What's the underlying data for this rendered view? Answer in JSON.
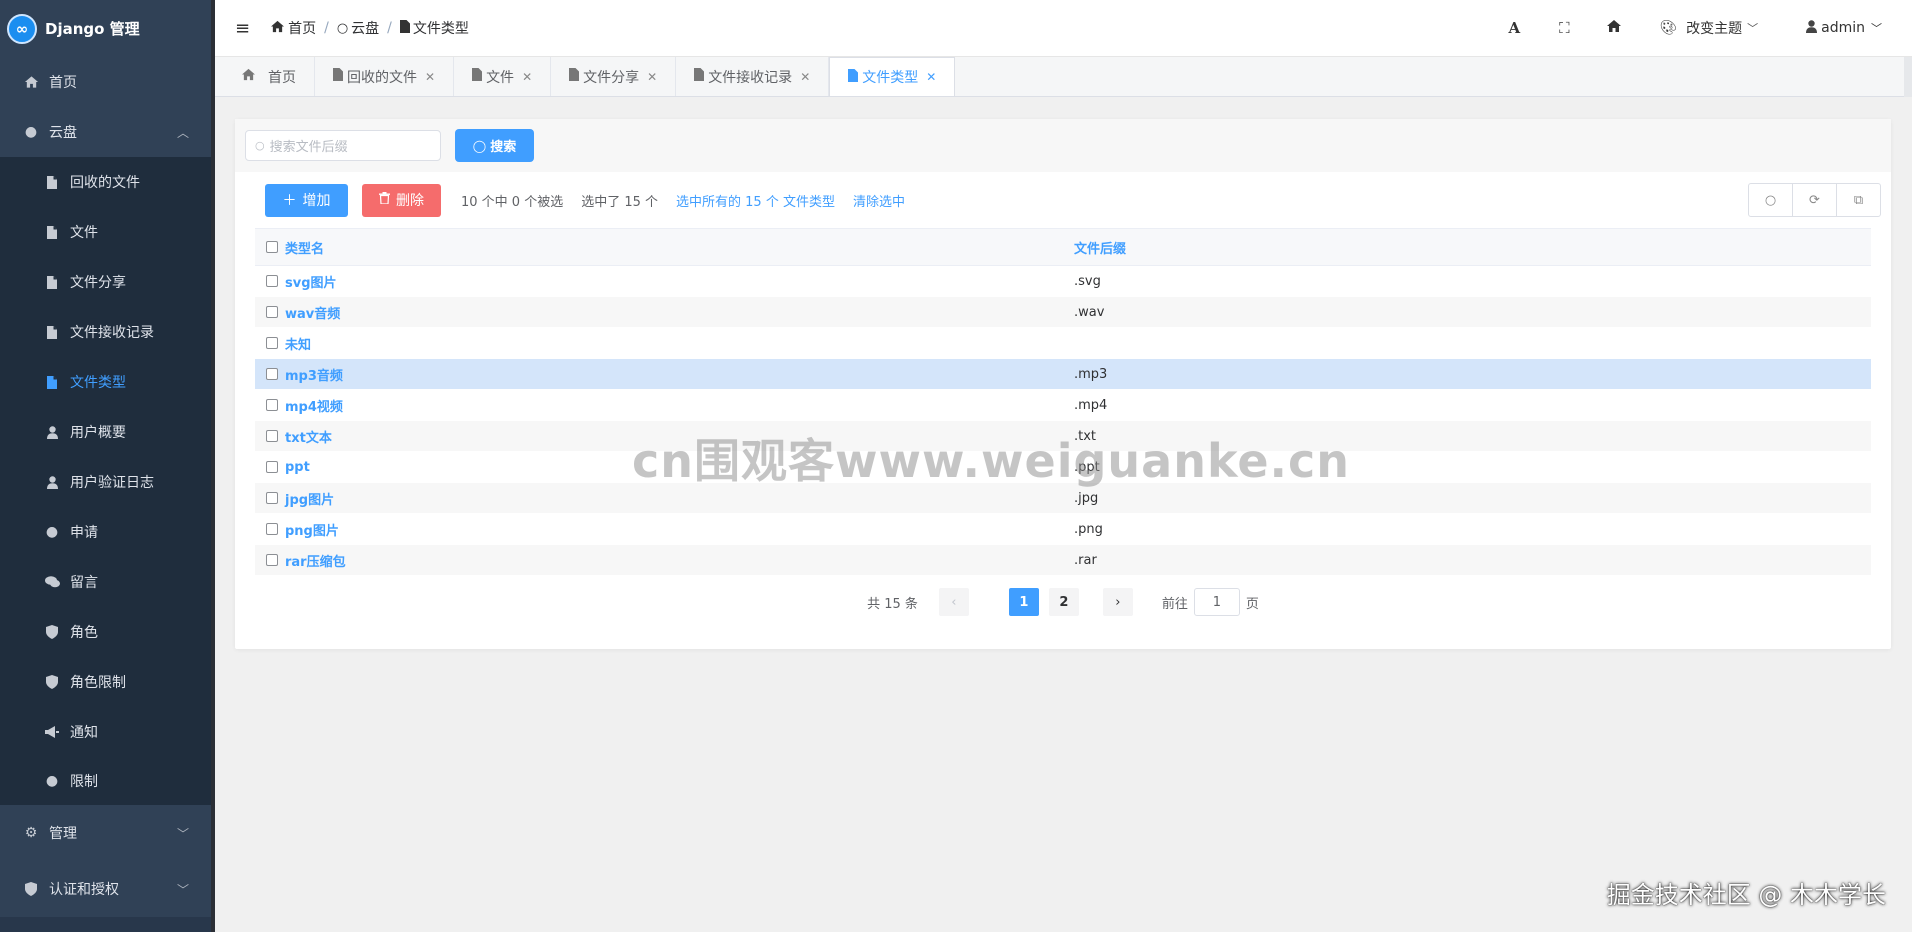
{
  "app": {
    "title": "Django 管理",
    "logo_glyph": "∞"
  },
  "sidebar": {
    "home": "首页",
    "cloud_group": "云盘",
    "cloud_items": [
      {
        "label": "回收的文件",
        "icon": "file-icon"
      },
      {
        "label": "文件",
        "icon": "file-icon"
      },
      {
        "label": "文件分享",
        "icon": "file-icon"
      },
      {
        "label": "文件接收记录",
        "icon": "file-icon"
      },
      {
        "label": "文件类型",
        "icon": "file-icon",
        "active": true
      },
      {
        "label": "用户概要",
        "icon": "user-icon"
      },
      {
        "label": "用户验证日志",
        "icon": "user-icon"
      },
      {
        "label": "申请",
        "icon": "circle-icon"
      },
      {
        "label": "留言",
        "icon": "comments-icon"
      },
      {
        "label": "角色",
        "icon": "shield-icon"
      },
      {
        "label": "角色限制",
        "icon": "shield-icon"
      },
      {
        "label": "通知",
        "icon": "bullhorn-icon"
      },
      {
        "label": "限制",
        "icon": "circle-icon"
      }
    ],
    "manage_group": "管理",
    "auth_group": "认证和授权"
  },
  "topbar": {
    "breadcrumb": [
      "首页",
      "云盘",
      "文件类型"
    ],
    "theme_label": "改变主题",
    "user": "admin"
  },
  "tabs": [
    {
      "label": "首页",
      "closable": false
    },
    {
      "label": "回收的文件",
      "closable": true
    },
    {
      "label": "文件",
      "closable": true
    },
    {
      "label": "文件分享",
      "closable": true
    },
    {
      "label": "文件接收记录",
      "closable": true
    },
    {
      "label": "文件类型",
      "closable": true,
      "active": true
    }
  ],
  "search": {
    "placeholder": "搜索文件后缀",
    "button": "搜索"
  },
  "actions": {
    "add": "增加",
    "delete": "删除",
    "selection_info": "10 个中 0 个被选",
    "selected_count": "选中了 15 个",
    "select_all": "选中所有的 15 个 文件类型",
    "clear": "清除选中"
  },
  "table": {
    "headers": {
      "name": "类型名",
      "suffix": "文件后缀"
    },
    "rows": [
      {
        "name": "svg图片",
        "suffix": ".svg"
      },
      {
        "name": "wav音频",
        "suffix": ".wav"
      },
      {
        "name": "未知",
        "suffix": ""
      },
      {
        "name": "mp3音频",
        "suffix": ".mp3",
        "highlight": true
      },
      {
        "name": "mp4视频",
        "suffix": ".mp4"
      },
      {
        "name": "txt文本",
        "suffix": ".txt"
      },
      {
        "name": "ppt",
        "suffix": ".ppt"
      },
      {
        "name": "jpg图片",
        "suffix": ".jpg"
      },
      {
        "name": "png图片",
        "suffix": ".png"
      },
      {
        "name": "rar压缩包",
        "suffix": ".rar"
      }
    ]
  },
  "pagination": {
    "total": "共 15 条",
    "pages": [
      "1",
      "2"
    ],
    "current": "1",
    "goto_prefix": "前往",
    "goto_value": "1",
    "goto_suffix": "页"
  },
  "watermarks": {
    "center": "cn围观客www.weiguanke.cn",
    "corner": "掘金技术社区 @ 木木学长"
  },
  "colors": {
    "primary": "#409eff",
    "danger": "#f56c6c",
    "sidebar": "#28374b",
    "highlight_row": "#d4e5fa"
  }
}
